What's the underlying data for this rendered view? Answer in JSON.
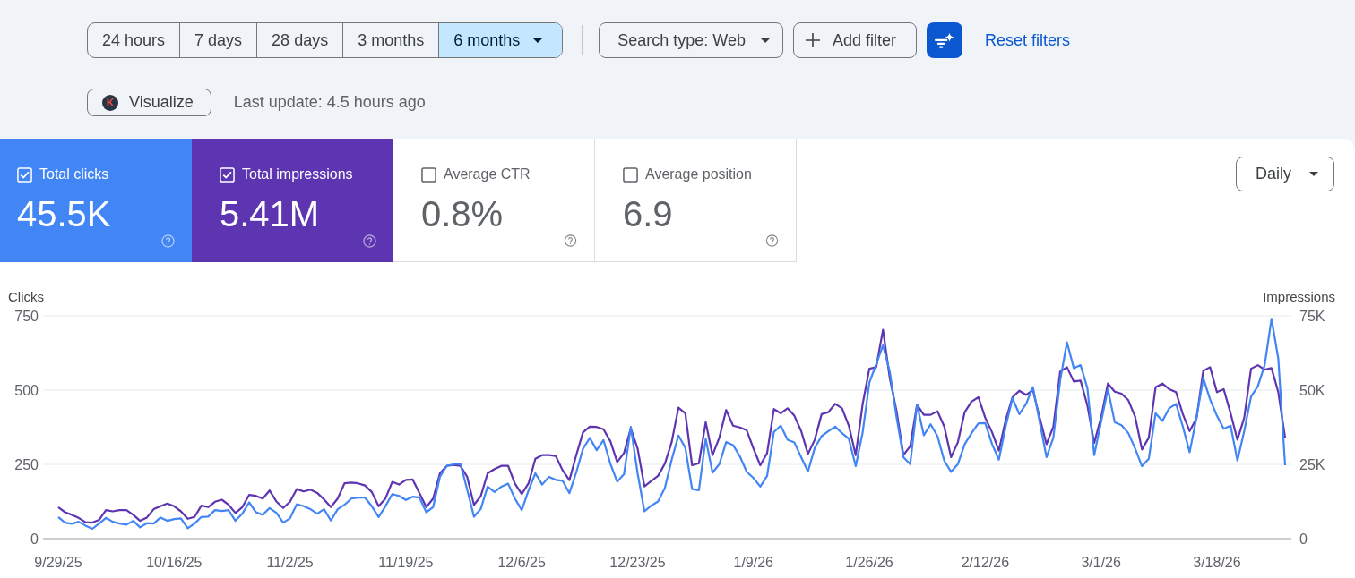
{
  "top_bar": {
    "date_ranges": [
      {
        "label": "24 hours",
        "selected": false,
        "kind": "option"
      },
      {
        "label": "7 days",
        "selected": false,
        "kind": "option"
      },
      {
        "label": "28 days",
        "selected": false,
        "kind": "option"
      },
      {
        "label": "3 months",
        "selected": false,
        "kind": "option"
      },
      {
        "label": "6 months",
        "selected": true,
        "kind": "menu"
      }
    ],
    "filters": [
      {
        "kind": "dropdown",
        "label": "Search type: Web"
      },
      {
        "kind": "add",
        "label": "Add filter"
      }
    ],
    "reset_link": "Reset filters"
  },
  "info_bar": {
    "visualize_button": {
      "logo": "K",
      "label": "Visualize"
    },
    "last_update": "Last update: 4.5 hours ago"
  },
  "metrics": [
    {
      "label": "Total clicks",
      "value": "45.5K",
      "checked": true,
      "color": "#4285f4"
    },
    {
      "label": "Total impressions",
      "value": "5.41M",
      "checked": true,
      "color": "#5e35b1"
    },
    {
      "label": "Average CTR",
      "value": "0.8%",
      "checked": false
    },
    {
      "label": "Average position",
      "value": "6.9",
      "checked": false
    }
  ],
  "granularity": {
    "label": "Daily"
  },
  "chart": {
    "chart_data": {
      "type": "line",
      "ylabel": "Clicks",
      "ylim": [
        0,
        750
      ],
      "yticks": [
        0,
        250,
        500,
        750
      ],
      "y2label": "Impressions",
      "y2lim": [
        0,
        75000
      ],
      "y2ticks": [
        {
          "value": 0,
          "label": "0"
        },
        {
          "value": 25000,
          "label": "25K"
        },
        {
          "value": 50000,
          "label": "50K"
        },
        {
          "value": 75000,
          "label": "75K"
        }
      ],
      "categories": [
        "9/29/25",
        null,
        null,
        null,
        null,
        null,
        null,
        null,
        null,
        null,
        null,
        null,
        null,
        null,
        null,
        null,
        null,
        "10/16/25",
        null,
        null,
        null,
        null,
        null,
        null,
        null,
        null,
        null,
        null,
        null,
        null,
        null,
        null,
        null,
        null,
        "11/2/25",
        null,
        null,
        null,
        null,
        null,
        null,
        null,
        null,
        null,
        null,
        null,
        null,
        null,
        null,
        null,
        null,
        "11/19/25",
        null,
        null,
        null,
        null,
        null,
        null,
        null,
        null,
        null,
        null,
        null,
        null,
        null,
        null,
        null,
        null,
        "12/6/25",
        null,
        null,
        null,
        null,
        null,
        null,
        null,
        null,
        null,
        null,
        null,
        null,
        null,
        null,
        null,
        null,
        "12/23/25",
        null,
        null,
        null,
        null,
        null,
        null,
        null,
        null,
        null,
        null,
        null,
        null,
        null,
        null,
        null,
        null,
        "1/9/26",
        null,
        null,
        null,
        null,
        null,
        null,
        null,
        null,
        null,
        null,
        null,
        null,
        null,
        null,
        null,
        null,
        "1/26/26",
        null,
        null,
        null,
        null,
        null,
        null,
        null,
        null,
        null,
        null,
        null,
        null,
        null,
        null,
        null,
        null,
        "2/12/26",
        null,
        null,
        null,
        null,
        null,
        null,
        null,
        null,
        null,
        null,
        null,
        null,
        null,
        null,
        null,
        null,
        "3/1/26",
        null,
        null,
        null,
        null,
        null,
        null,
        null,
        null,
        null,
        null,
        null,
        null,
        null,
        null,
        null,
        null,
        "3/18/26",
        null,
        null,
        null,
        null,
        null,
        null,
        null,
        null,
        null,
        null
      ],
      "series": [
        {
          "color": "#4285f4",
          "values": [
            73,
            54,
            50,
            57,
            44,
            33,
            51,
            70,
            57,
            51,
            47,
            60,
            38,
            52,
            51,
            71,
            60,
            66,
            68,
            35,
            51,
            73,
            74,
            96,
            93,
            96,
            60,
            84,
            122,
            89,
            80,
            103,
            87,
            54,
            68,
            116,
            109,
            99,
            84,
            99,
            61,
            99,
            114,
            135,
            138,
            138,
            109,
            73,
            109,
            150,
            144,
            130,
            141,
            138,
            89,
            106,
            208,
            245,
            250,
            253,
            165,
            74,
            100,
            175,
            157,
            175,
            185,
            135,
            96,
            162,
            220,
            182,
            208,
            198,
            195,
            153,
            223,
            303,
            339,
            298,
            332,
            252,
            192,
            217,
            376,
            220,
            92,
            111,
            125,
            170,
            266,
            347,
            306,
            167,
            163,
            336,
            222,
            251,
            325,
            315,
            277,
            225,
            204,
            175,
            211,
            359,
            380,
            333,
            324,
            274,
            226,
            306,
            345,
            362,
            377,
            355,
            336,
            244,
            355,
            525,
            587,
            651,
            562,
            407,
            274,
            251,
            451,
            348,
            385,
            345,
            262,
            225,
            251,
            318,
            355,
            388,
            389,
            318,
            266,
            377,
            473,
            419,
            454,
            510,
            392,
            274,
            340,
            532,
            661,
            574,
            584,
            507,
            281,
            392,
            503,
            392,
            382,
            355,
            303,
            244,
            269,
            422,
            396,
            439,
            454,
            377,
            291,
            407,
            540,
            469,
            414,
            370,
            380,
            263,
            362,
            478,
            513,
            584,
            740,
            606,
            247
          ]
        },
        {
          "color": "#5e35b1",
          "axis": "y2",
          "values": [
            10600,
            8900,
            8000,
            7000,
            5500,
            5400,
            6300,
            9600,
            9200,
            9600,
            9600,
            8000,
            6000,
            7100,
            9900,
            10900,
            11800,
            10900,
            9200,
            6700,
            7300,
            11100,
            10600,
            12400,
            13100,
            11400,
            8600,
            10600,
            14700,
            14400,
            13500,
            16200,
            12500,
            10300,
            12400,
            16700,
            15900,
            16500,
            15400,
            13200,
            10600,
            13500,
            18600,
            18900,
            18600,
            17900,
            15700,
            10900,
            13500,
            19100,
            18200,
            19800,
            19900,
            15300,
            10600,
            13500,
            22000,
            24500,
            24800,
            24500,
            20800,
            11400,
            14300,
            22000,
            23400,
            24500,
            24500,
            18500,
            15000,
            18600,
            26900,
            28100,
            28100,
            27800,
            23000,
            19700,
            28100,
            35800,
            37700,
            37600,
            36800,
            32800,
            25800,
            28800,
            37100,
            30300,
            17600,
            19400,
            21100,
            25200,
            32500,
            44100,
            42200,
            24700,
            25400,
            39200,
            28100,
            34000,
            43300,
            38000,
            37400,
            36500,
            30300,
            24700,
            28800,
            43600,
            42200,
            43900,
            41400,
            36200,
            28500,
            33300,
            41900,
            42600,
            45400,
            43900,
            38000,
            28100,
            45100,
            57200,
            57700,
            70300,
            54000,
            42900,
            28100,
            31100,
            45100,
            41700,
            41700,
            42900,
            37700,
            27400,
            32500,
            42600,
            46100,
            47600,
            40700,
            35800,
            29600,
            39900,
            47600,
            49800,
            48400,
            50000,
            40700,
            31800,
            37700,
            56200,
            57700,
            52900,
            53200,
            44800,
            32200,
            40700,
            52200,
            49500,
            48800,
            46600,
            41000,
            30000,
            34000,
            51000,
            52200,
            50300,
            49300,
            41900,
            36200,
            40400,
            56500,
            57700,
            49300,
            50300,
            42200,
            33300,
            40700,
            57200,
            58400,
            56900,
            57400,
            49300,
            34000
          ]
        }
      ]
    }
  }
}
